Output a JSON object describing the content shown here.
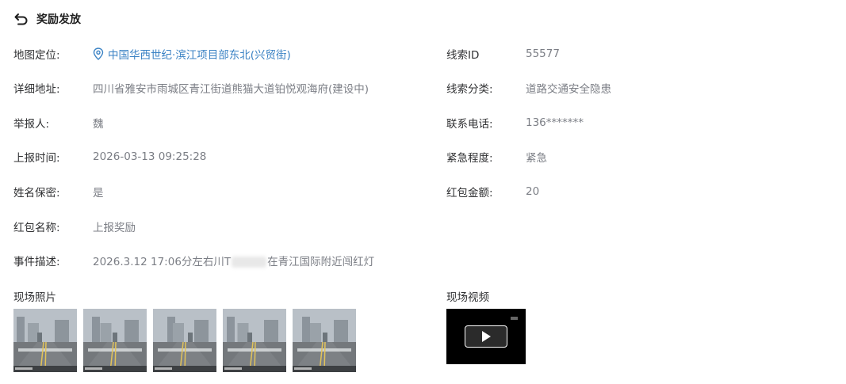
{
  "header": {
    "title": "奖励发放",
    "back_icon": "back-arrow-icon"
  },
  "fields_left": {
    "location_label": "地图定位:",
    "location_value": "中国华西世纪·滨江项目部东北(兴贸街)",
    "address_label": "详细地址:",
    "address_value": "四川省雅安市雨城区青江街道熊猫大道铂悦观海府(建设中)",
    "reporter_label": "举报人:",
    "reporter_value": "魏",
    "report_time_label": "上报时间:",
    "report_time_value": "2026-03-13 09:25:28",
    "anonymous_label": "姓名保密:",
    "anonymous_value": "是",
    "reward_name_label": "红包名称:",
    "reward_name_value": "上报奖励",
    "description_label": "事件描述:",
    "description_prefix": "2026.3.12 17:06分左右川T",
    "description_suffix": "在青江国际附近闯红灯"
  },
  "fields_right": {
    "clue_id_label": "线索ID",
    "clue_id_value": "55577",
    "clue_type_label": "线索分类:",
    "clue_type_value": "道路交通安全隐患",
    "phone_label": "联系电话:",
    "phone_value": "136*******",
    "urgency_label": "紧急程度:",
    "urgency_value": "紧急",
    "amount_label": "红包金额:",
    "amount_value": "20"
  },
  "media": {
    "photos_title": "现场照片",
    "video_title": "现场视频",
    "photo_count": 5
  },
  "colors": {
    "link": "#3a82c4",
    "label": "#303133",
    "value": "#7b7e85"
  }
}
